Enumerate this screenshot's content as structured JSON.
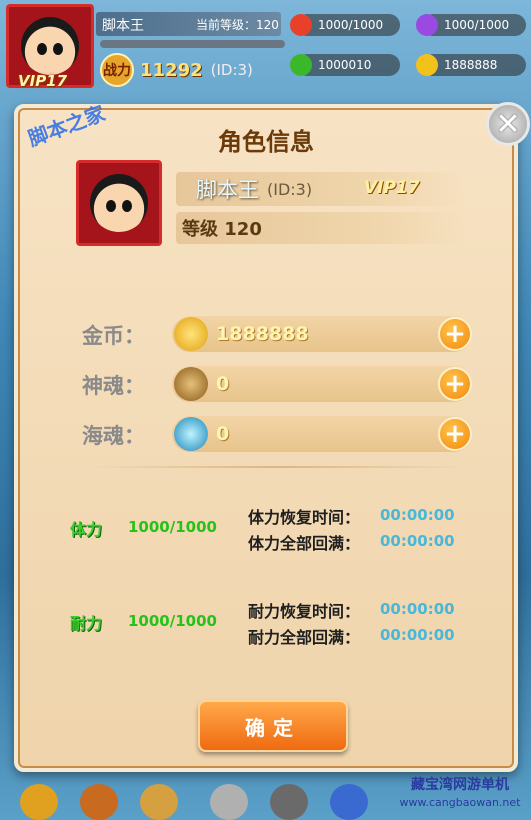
{
  "hud": {
    "player_name": "脚本王",
    "level_text": "当前等级：120",
    "vip": "VIP17",
    "power_icon_text": "战力",
    "power": "11292",
    "id": "(ID:3)",
    "resources": {
      "red": "1000/1000",
      "purple": "1000/1000",
      "green": "1000010",
      "gold": "1888888"
    },
    "colors": {
      "red": "#e8402a",
      "purple": "#9a4ae0",
      "green": "#3bb82a",
      "gold": "#f2c21a"
    }
  },
  "watermark": {
    "top": "脚本之家",
    "bottom": "藏宝湾网游单机",
    "url": "www.cangbaowan.net"
  },
  "dialog": {
    "title": "角色信息",
    "close_label": "✕",
    "name": "脚本王",
    "id": "(ID:3)",
    "vip": "VIP17",
    "level": "等级 120",
    "currencies": [
      {
        "label": "金币：",
        "value": "1888888",
        "icon": "gold-coin-icon"
      },
      {
        "label": "神魂：",
        "value": "0",
        "icon": "divine-soul-icon"
      },
      {
        "label": "海魂：",
        "value": "0",
        "icon": "sea-soul-icon"
      }
    ],
    "stamina": {
      "label": "体力",
      "value": "1000/1000",
      "recover_label": "体力恢复时间：",
      "recover_value": "00:00:00",
      "full_label": "体力全部回满：",
      "full_value": "00:00:00"
    },
    "endurance": {
      "label": "耐力",
      "value": "1000/1000",
      "recover_label": "耐力恢复时间：",
      "recover_value": "00:00:00",
      "full_label": "耐力全部回满：",
      "full_value": "00:00:00"
    },
    "confirm_label": "确定"
  }
}
